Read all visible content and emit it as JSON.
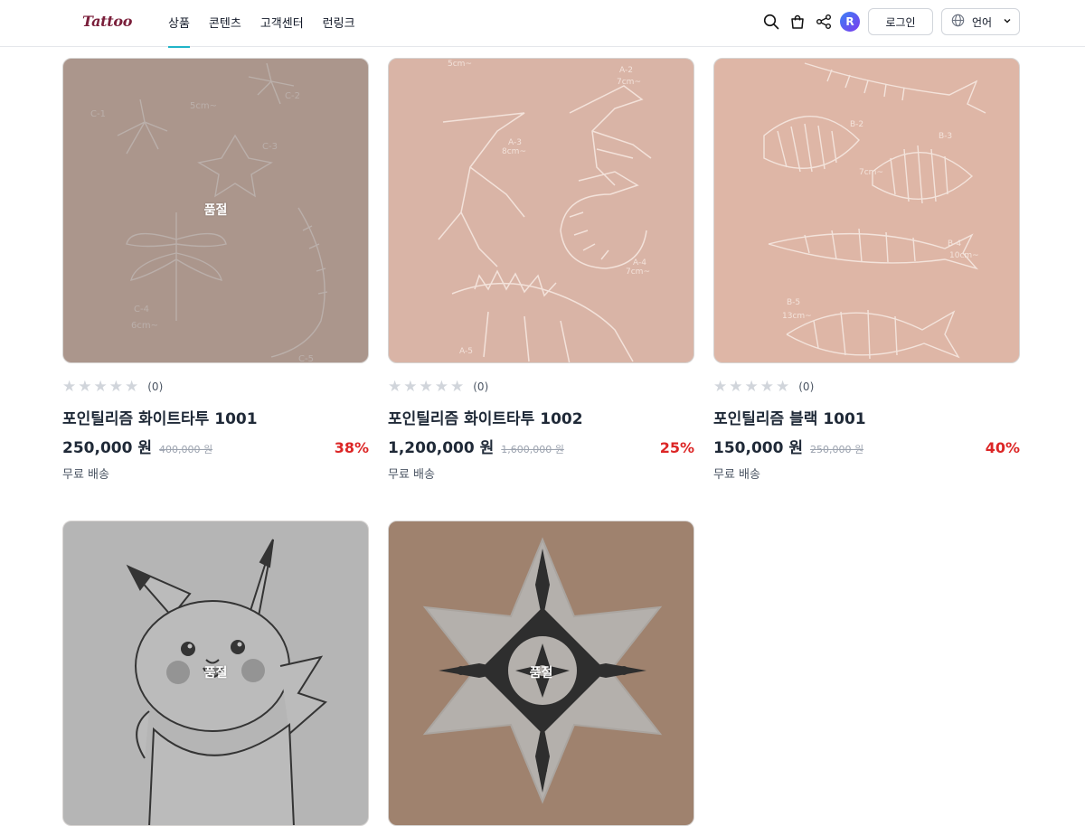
{
  "header": {
    "logo": "Tattoo",
    "nav": [
      "상품",
      "콘텐츠",
      "고객센터",
      "런링크"
    ],
    "login_label": "로그인",
    "language_label": "언어",
    "avatar_letter": "R"
  },
  "products": [
    {
      "title": "포인틸리즘 화이트타투 1001",
      "price": "250,000 원",
      "original_price": "400,000 원",
      "discount": "38%",
      "shipping": "무료 배송",
      "rating_count": "(0)",
      "sold_out": "품절",
      "bg": "#d9b8aa"
    },
    {
      "title": "포인틸리즘 화이트타투 1002",
      "price": "1,200,000 원",
      "original_price": "1,600,000 원",
      "discount": "25%",
      "shipping": "무료 배송",
      "rating_count": "(0)",
      "sold_out": "",
      "bg": "#d9b4a6"
    },
    {
      "title": "포인틸리즘 블랙 1001",
      "price": "150,000 원",
      "original_price": "250,000 원",
      "discount": "40%",
      "shipping": "무료 배송",
      "rating_count": "(0)",
      "sold_out": "",
      "bg": "#deb6a6"
    },
    {
      "title": "",
      "price": "",
      "original_price": "",
      "discount": "",
      "shipping": "",
      "rating_count": "",
      "sold_out": "품절",
      "bg": "#e8e8e8"
    },
    {
      "title": "",
      "price": "",
      "original_price": "",
      "discount": "",
      "shipping": "",
      "rating_count": "",
      "sold_out": "품절",
      "bg": "#c69a7c"
    }
  ],
  "colors": {
    "accent": "#20b4c8",
    "discount": "#dc2626",
    "logo": "#7a1e3a"
  }
}
